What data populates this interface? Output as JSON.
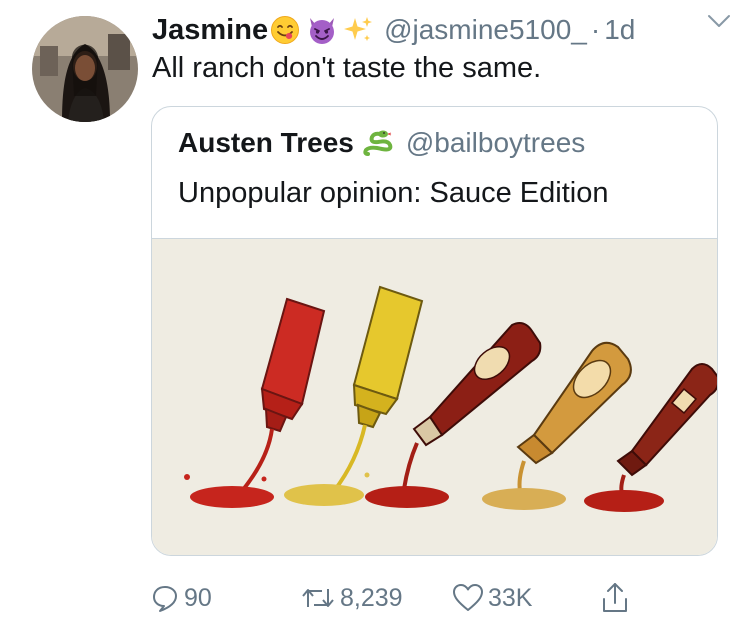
{
  "tweet": {
    "display_name": "Jasmine",
    "handle": "@jasmine5100_",
    "separator": "·",
    "time": "1d",
    "text": "All ranch don't taste the same.",
    "name_emojis": [
      "yum-face-icon",
      "smiling-devil-icon",
      "sparkles-icon"
    ]
  },
  "quote": {
    "display_name": "Austen Trees",
    "name_emoji": "snake-icon",
    "handle": "@bailboytrees",
    "text": "Unpopular opinion: Sauce Edition",
    "media_description_icon": "sauce-bottles-illustration"
  },
  "actions": {
    "reply_count": "90",
    "retweet_count": "8,239",
    "like_count": "33K"
  },
  "colors": {
    "text": "#14171a",
    "secondary": "#657786",
    "border": "#ccd6dd",
    "media_bg": "#efece2"
  }
}
